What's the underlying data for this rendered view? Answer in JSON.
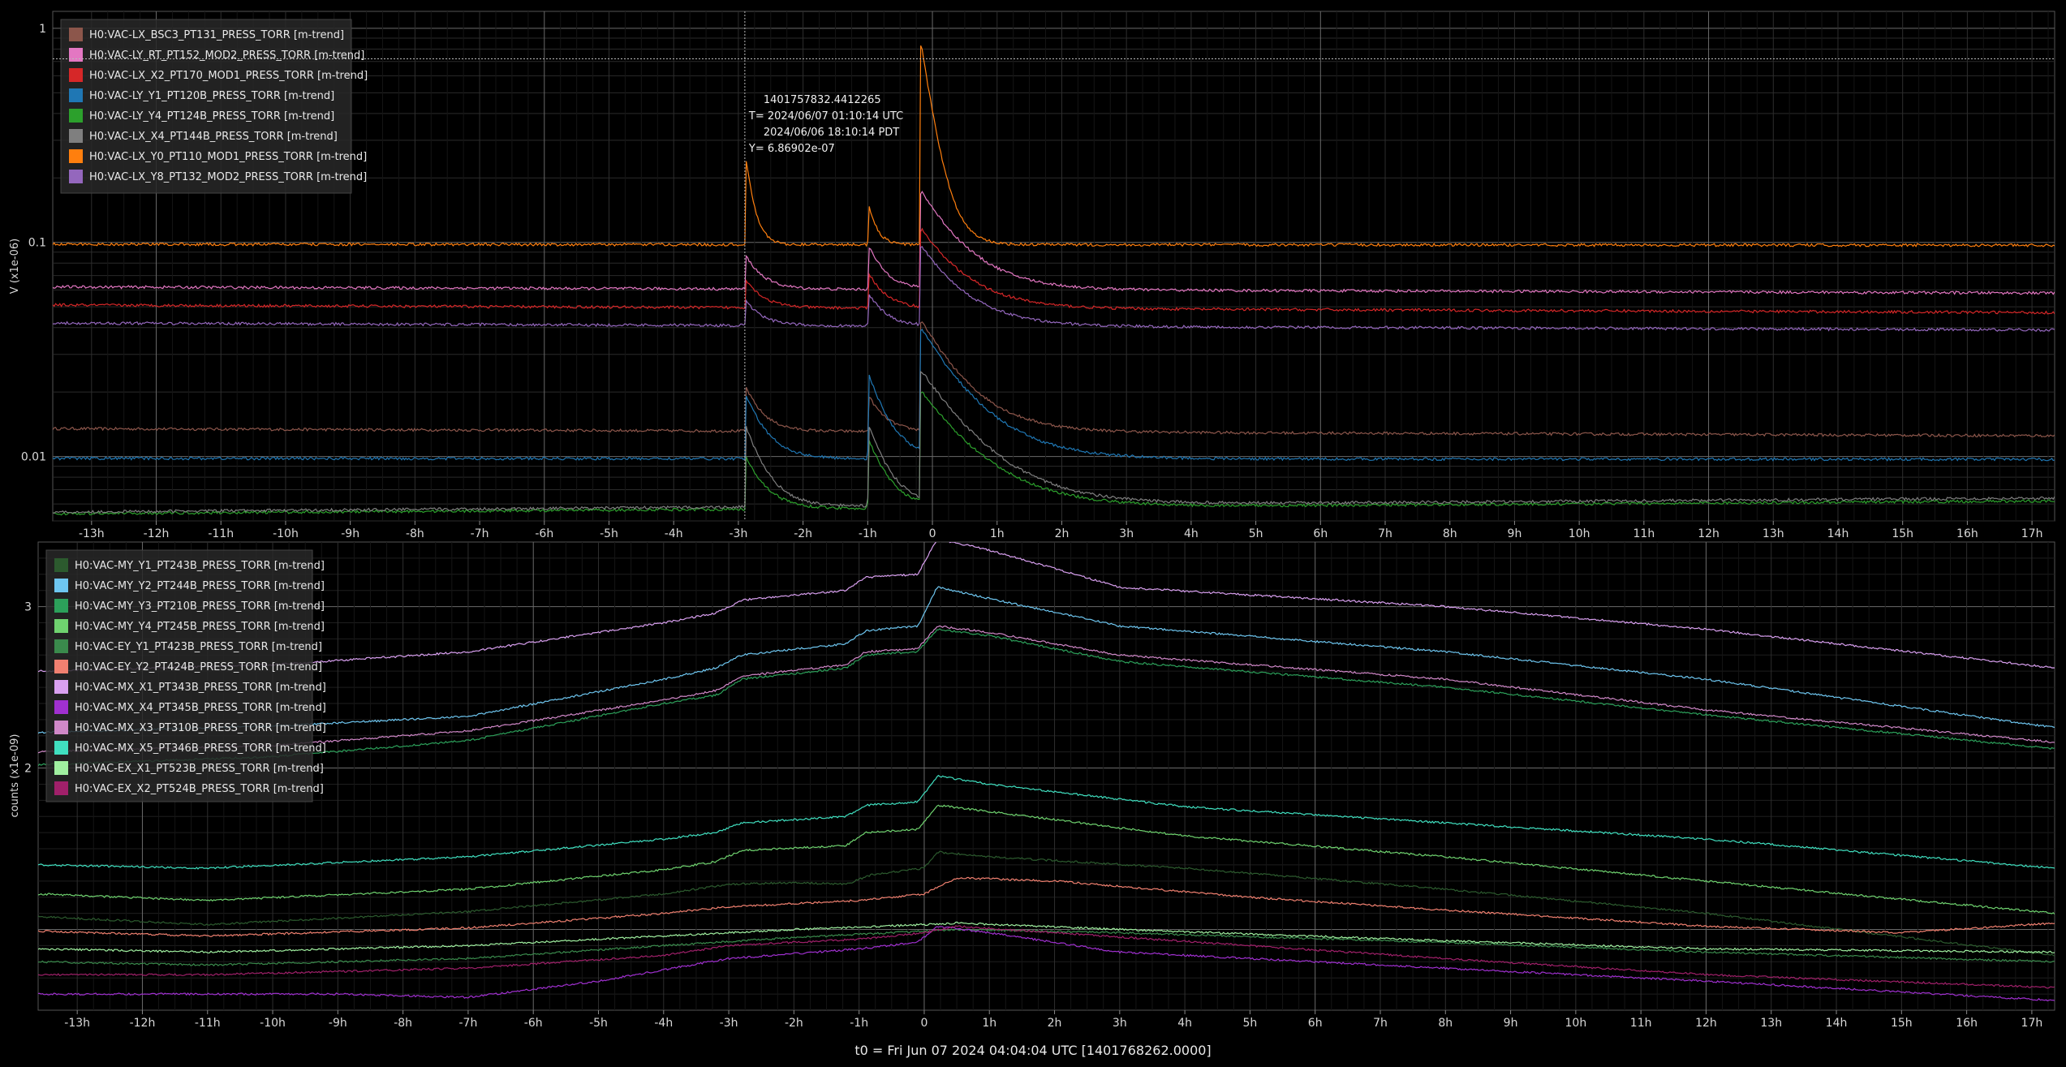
{
  "chart_data": [
    {
      "type": "line",
      "title": "",
      "xlabel": "",
      "ylabel": "V (x1e-06)",
      "yscale": "log",
      "ylim": [
        0.005,
        1.2
      ],
      "xlim": [
        -13.6,
        17.35
      ],
      "x_unit": "h",
      "x_ticks": [
        "-13h",
        "-12h",
        "-11h",
        "-10h",
        "-9h",
        "-8h",
        "-7h",
        "-6h",
        "-5h",
        "-4h",
        "-3h",
        "-2h",
        "-1h",
        "0",
        "1h",
        "2h",
        "3h",
        "4h",
        "5h",
        "6h",
        "7h",
        "8h",
        "9h",
        "10h",
        "11h",
        "12h",
        "13h",
        "14h",
        "15h",
        "16h",
        "17h"
      ],
      "y_ticks": [
        "1",
        "0.1",
        "0.01"
      ],
      "grid": true,
      "legend_position": "top-left",
      "hover": {
        "lines": [
          "1401757832.4412265",
          "T= 2024/06/07 01:10:14 UTC",
          "2024/06/06 18:10:14 PDT",
          "Y= 6.86902e-07"
        ],
        "x": -2.9,
        "y_level": 0.72
      },
      "events": [
        -2.9,
        -1.0,
        -0.2
      ],
      "series": [
        {
          "name": "H0:VAC-LX_BSC3_PT131_PRESS_TORR [m-trend]",
          "color": "#8c564b",
          "baseline": 0.0135,
          "end": 0.0125,
          "peak": [
            0.022,
            0.02,
            0.045
          ],
          "decay": [
            0.25,
            0.25,
            0.6
          ]
        },
        {
          "name": "H0:VAC-LY_RT_PT152_MOD2_PRESS_TORR [m-trend]",
          "color": "#e377c2",
          "baseline": 0.062,
          "end": 0.058,
          "peak": [
            0.09,
            0.1,
            0.18
          ],
          "decay": [
            0.25,
            0.25,
            0.6
          ]
        },
        {
          "name": "H0:VAC-LX_X2_PT170_MOD1_PRESS_TORR [m-trend]",
          "color": "#d62728",
          "baseline": 0.051,
          "end": 0.047,
          "peak": [
            0.07,
            0.075,
            0.12
          ],
          "decay": [
            0.25,
            0.25,
            0.6
          ]
        },
        {
          "name": "H0:VAC-LY_Y1_PT120B_PRESS_TORR [m-trend]",
          "color": "#1f77b4",
          "baseline": 0.0098,
          "end": 0.0097,
          "peak": [
            0.02,
            0.025,
            0.04
          ],
          "decay": [
            0.3,
            0.3,
            0.7
          ]
        },
        {
          "name": "H0:VAC-LY_Y4_PT124B_PRESS_TORR [m-trend]",
          "color": "#2ca02c",
          "baseline": 0.0054,
          "end": 0.0062,
          "peak": [
            0.01,
            0.012,
            0.02
          ],
          "decay": [
            0.3,
            0.3,
            0.8
          ]
        },
        {
          "name": "H0:VAC-LX_X4_PT144B_PRESS_TORR [m-trend]",
          "color": "#7f7f7f",
          "baseline": 0.0055,
          "end": 0.0064,
          "peak": [
            0.014,
            0.014,
            0.025
          ],
          "decay": [
            0.3,
            0.3,
            0.8
          ]
        },
        {
          "name": "H0:VAC-LX_Y0_PT110_MOD1_PRESS_TORR [m-trend]",
          "color": "#ff7f0e",
          "baseline": 0.098,
          "end": 0.097,
          "peak": [
            0.27,
            0.16,
            0.95
          ],
          "decay": [
            0.12,
            0.12,
            0.2
          ]
        },
        {
          "name": "H0:VAC-LX_Y8_PT132_MOD2_PRESS_TORR [m-trend]",
          "color": "#9467bd",
          "baseline": 0.042,
          "end": 0.039,
          "peak": [
            0.055,
            0.06,
            0.1
          ],
          "decay": [
            0.25,
            0.25,
            0.6
          ]
        }
      ]
    },
    {
      "type": "line",
      "title": "",
      "xlabel": "",
      "ylabel": "counts (x1e-09)",
      "yscale": "linear",
      "ylim": [
        0.5,
        3.4
      ],
      "xlim": [
        -13.6,
        17.35
      ],
      "x_unit": "h",
      "x_ticks": [
        "-13h",
        "-12h",
        "-11h",
        "-10h",
        "-9h",
        "-8h",
        "-7h",
        "-6h",
        "-5h",
        "-4h",
        "-3h",
        "-2h",
        "-1h",
        "0",
        "1h",
        "2h",
        "3h",
        "4h",
        "5h",
        "6h",
        "7h",
        "8h",
        "9h",
        "10h",
        "11h",
        "12h",
        "13h",
        "14h",
        "15h",
        "16h",
        "17h"
      ],
      "y_ticks": [
        "3",
        "2"
      ],
      "grid": true,
      "legend_position": "top-left",
      "series": [
        {
          "name": "H0:VAC-MY_Y1_PT243B_PRESS_TORR [m-trend]",
          "color": "#2c5a2e",
          "points": [
            [
              -13.6,
              1.08
            ],
            [
              -11,
              1.03
            ],
            [
              -7,
              1.11
            ],
            [
              -4,
              1.22
            ],
            [
              -3,
              1.28
            ],
            [
              -2,
              1.29
            ],
            [
              -1.2,
              1.28
            ],
            [
              -0.8,
              1.34
            ],
            [
              0,
              1.38
            ],
            [
              0.2,
              1.48
            ],
            [
              1,
              1.45
            ],
            [
              4,
              1.38
            ],
            [
              8,
              1.25
            ],
            [
              12,
              1.1
            ],
            [
              17.35,
              0.84
            ]
          ]
        },
        {
          "name": "H0:VAC-MY_Y2_PT244B_PRESS_TORR [m-trend]",
          "color": "#6ec6f0",
          "points": [
            [
              -13.6,
              2.22
            ],
            [
              -10,
              2.26
            ],
            [
              -7,
              2.32
            ],
            [
              -4,
              2.55
            ],
            [
              -3.2,
              2.62
            ],
            [
              -2.8,
              2.7
            ],
            [
              -1.2,
              2.77
            ],
            [
              -0.9,
              2.85
            ],
            [
              -0.1,
              2.88
            ],
            [
              0.2,
              3.12
            ],
            [
              1,
              3.05
            ],
            [
              3,
              2.88
            ],
            [
              8,
              2.72
            ],
            [
              12,
              2.55
            ],
            [
              17.35,
              2.25
            ]
          ]
        },
        {
          "name": "H0:VAC-MY_Y3_PT210B_PRESS_TORR [m-trend]",
          "color": "#2ca05a",
          "points": [
            [
              -13.6,
              2.02
            ],
            [
              -10,
              2.07
            ],
            [
              -7,
              2.17
            ],
            [
              -4,
              2.4
            ],
            [
              -3.2,
              2.45
            ],
            [
              -2.8,
              2.55
            ],
            [
              -1.2,
              2.62
            ],
            [
              -0.9,
              2.7
            ],
            [
              -0.1,
              2.72
            ],
            [
              0.2,
              2.86
            ],
            [
              1,
              2.82
            ],
            [
              3,
              2.66
            ],
            [
              8,
              2.5
            ],
            [
              12,
              2.33
            ],
            [
              17.35,
              2.12
            ]
          ]
        },
        {
          "name": "H0:VAC-MY_Y4_PT245B_PRESS_TORR [m-trend]",
          "color": "#6fd36f",
          "points": [
            [
              -13.6,
              1.22
            ],
            [
              -11,
              1.18
            ],
            [
              -7,
              1.25
            ],
            [
              -4,
              1.37
            ],
            [
              -3.2,
              1.42
            ],
            [
              -2.8,
              1.49
            ],
            [
              -1.2,
              1.52
            ],
            [
              -0.9,
              1.6
            ],
            [
              -0.1,
              1.62
            ],
            [
              0.2,
              1.77
            ],
            [
              1,
              1.73
            ],
            [
              4,
              1.58
            ],
            [
              8,
              1.45
            ],
            [
              12,
              1.3
            ],
            [
              17.35,
              1.1
            ]
          ]
        },
        {
          "name": "H0:VAC-EY_Y1_PT423B_PRESS_TORR [m-trend]",
          "color": "#3a8a4c",
          "points": [
            [
              -13.6,
              0.8
            ],
            [
              -11,
              0.78
            ],
            [
              -7,
              0.82
            ],
            [
              -4,
              0.9
            ],
            [
              -2,
              0.95
            ],
            [
              0,
              0.99
            ],
            [
              0.5,
              1.0
            ],
            [
              3,
              0.98
            ],
            [
              8,
              0.92
            ],
            [
              12,
              0.86
            ],
            [
              17.35,
              0.8
            ]
          ]
        },
        {
          "name": "H0:VAC-EY_Y2_PT424B_PRESS_TORR [m-trend]",
          "color": "#f08070",
          "points": [
            [
              -13.6,
              0.99
            ],
            [
              -11,
              0.96
            ],
            [
              -7,
              1.01
            ],
            [
              -4,
              1.1
            ],
            [
              -3,
              1.14
            ],
            [
              -1,
              1.18
            ],
            [
              0,
              1.22
            ],
            [
              0.5,
              1.32
            ],
            [
              2,
              1.3
            ],
            [
              5,
              1.2
            ],
            [
              8,
              1.12
            ],
            [
              12,
              1.02
            ],
            [
              15,
              0.98
            ],
            [
              17.35,
              1.04
            ]
          ]
        },
        {
          "name": "H0:VAC-MX_X1_PT343B_PRESS_TORR [m-trend]",
          "color": "#d9a0f0",
          "points": [
            [
              -13.6,
              2.6
            ],
            [
              -10,
              2.64
            ],
            [
              -7,
              2.72
            ],
            [
              -4,
              2.9
            ],
            [
              -3.2,
              2.96
            ],
            [
              -2.8,
              3.04
            ],
            [
              -1.2,
              3.1
            ],
            [
              -0.9,
              3.18
            ],
            [
              -0.1,
              3.2
            ],
            [
              0.2,
              3.42
            ],
            [
              1,
              3.35
            ],
            [
              3,
              3.12
            ],
            [
              8,
              3.0
            ],
            [
              12,
              2.86
            ],
            [
              17.35,
              2.62
            ]
          ]
        },
        {
          "name": "H0:VAC-MX_X4_PT345B_PRESS_TORR [m-trend]",
          "color": "#a030d0",
          "points": [
            [
              -13.6,
              0.6
            ],
            [
              -9,
              0.6
            ],
            [
              -7,
              0.58
            ],
            [
              -5,
              0.68
            ],
            [
              -3,
              0.82
            ],
            [
              -1,
              0.88
            ],
            [
              -0.1,
              0.92
            ],
            [
              0.2,
              1.02
            ],
            [
              1,
              0.98
            ],
            [
              3,
              0.86
            ],
            [
              8,
              0.76
            ],
            [
              12,
              0.68
            ],
            [
              17.35,
              0.56
            ]
          ]
        },
        {
          "name": "H0:VAC-MX_X3_PT310B_PRESS_TORR [m-trend]",
          "color": "#d088c8",
          "points": [
            [
              -13.6,
              2.1
            ],
            [
              -10,
              2.14
            ],
            [
              -7,
              2.23
            ],
            [
              -4,
              2.42
            ],
            [
              -3.2,
              2.48
            ],
            [
              -2.8,
              2.57
            ],
            [
              -1.2,
              2.64
            ],
            [
              -0.9,
              2.72
            ],
            [
              -0.1,
              2.74
            ],
            [
              0.2,
              2.88
            ],
            [
              1,
              2.84
            ],
            [
              3,
              2.7
            ],
            [
              8,
              2.55
            ],
            [
              12,
              2.36
            ],
            [
              17.35,
              2.16
            ]
          ]
        },
        {
          "name": "H0:VAC-MX_X5_PT346B_PRESS_TORR [m-trend]",
          "color": "#40e0c0",
          "points": [
            [
              -13.6,
              1.4
            ],
            [
              -11,
              1.38
            ],
            [
              -7,
              1.45
            ],
            [
              -4,
              1.56
            ],
            [
              -3.2,
              1.6
            ],
            [
              -2.8,
              1.66
            ],
            [
              -1.2,
              1.7
            ],
            [
              -0.9,
              1.77
            ],
            [
              -0.1,
              1.79
            ],
            [
              0.2,
              1.95
            ],
            [
              1,
              1.9
            ],
            [
              4,
              1.76
            ],
            [
              8,
              1.66
            ],
            [
              12,
              1.56
            ],
            [
              17.35,
              1.38
            ]
          ]
        },
        {
          "name": "H0:VAC-EX_X1_PT523B_PRESS_TORR [m-trend]",
          "color": "#a0f0a0",
          "points": [
            [
              -13.6,
              0.88
            ],
            [
              -11,
              0.86
            ],
            [
              -7,
              0.9
            ],
            [
              -4,
              0.96
            ],
            [
              -2,
              1.0
            ],
            [
              0,
              1.03
            ],
            [
              0.5,
              1.04
            ],
            [
              3,
              1.0
            ],
            [
              8,
              0.93
            ],
            [
              12,
              0.88
            ],
            [
              17.35,
              0.86
            ]
          ]
        },
        {
          "name": "H0:VAC-EX_X2_PT524B_PRESS_TORR [m-trend]",
          "color": "#a0206a",
          "points": [
            [
              -13.6,
              0.72
            ],
            [
              -11,
              0.72
            ],
            [
              -7,
              0.76
            ],
            [
              -4,
              0.84
            ],
            [
              -3,
              0.9
            ],
            [
              -1,
              0.94
            ],
            [
              0,
              0.98
            ],
            [
              0.5,
              1.02
            ],
            [
              2,
              0.98
            ],
            [
              5,
              0.9
            ],
            [
              8,
              0.82
            ],
            [
              12,
              0.72
            ],
            [
              17.35,
              0.64
            ]
          ]
        }
      ]
    }
  ],
  "footer": {
    "t0_label": "t0 = Fri Jun 07 2024 04:04:04 UTC [1401768262.0000]"
  }
}
